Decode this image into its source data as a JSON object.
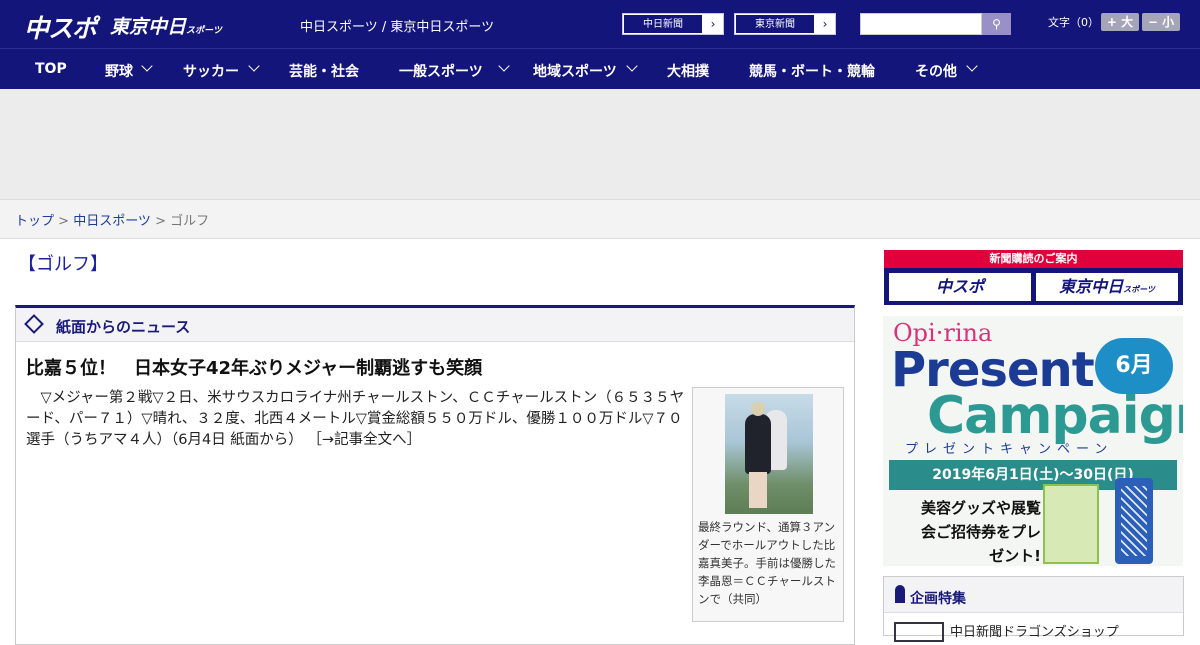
{
  "header": {
    "logo_chuspo": "中スポ",
    "logo_tokyo": "東京中日",
    "logo_tokyo_sub": "スポーツ",
    "site_links": "中日スポーツ / 東京中日スポーツ",
    "ext_links": [
      {
        "label": "中日新聞"
      },
      {
        "label": "東京新聞"
      }
    ],
    "search_placeholder": "",
    "search_icon": "search-icon",
    "font_size_label": "文字（0）",
    "font_bigger": "+ 大",
    "font_smaller": "− 小"
  },
  "nav": {
    "items": [
      {
        "label": "TOP",
        "dropdown": false
      },
      {
        "label": "野球",
        "dropdown": true
      },
      {
        "label": "サッカー",
        "dropdown": true
      },
      {
        "label": "芸能・社会",
        "dropdown": false
      },
      {
        "label": "一般スポーツ",
        "dropdown": true
      },
      {
        "label": "地域スポーツ",
        "dropdown": true
      },
      {
        "label": "大相撲",
        "dropdown": false
      },
      {
        "label": "競馬・ボート・競輪",
        "dropdown": false
      },
      {
        "label": "その他",
        "dropdown": true
      }
    ]
  },
  "breadcrumb": {
    "top": "トップ",
    "sep1": " > ",
    "chunichi": "中日スポーツ",
    "sep2": " > ",
    "current": "ゴルフ"
  },
  "category_title": "【ゴルフ】",
  "news": {
    "section_title": "紙面からのニュース",
    "article": {
      "title": "比嘉５位！　日本女子42年ぶりメジャー制覇逃すも笑顔",
      "body": "　▽メジャー第２戦▽２日、米サウスカロライナ州チャールストン、ＣＣチャールストン（６５３５ヤード、パー７１）▽晴れ、３２度、北西４メートル▽賞金総額５５０万ドル、優勝１００万ドル▽７０選手（うちアマ４人）（6月4日 紙面から）",
      "more_link": "［→記事全文へ］",
      "photo_caption": "最終ラウンド、通算３アンダーでホールアウトした比嘉真美子。手前は優勝した李晶恩＝ＣＣチャールストンで（共同）"
    }
  },
  "sidebar": {
    "subscribe_title": "新聞購読のご案内",
    "subscribe_chuspo": "中スポ",
    "subscribe_tokyo": "東京中日",
    "subscribe_tokyo_sub": "スポーツ",
    "banner": {
      "brand": "Opi·rina",
      "line1": "Present",
      "line2": "Campaign",
      "month": "6月",
      "kana": "プレゼントキャンペーン",
      "dates": "2019年6月1日(土)〜30日(日)",
      "promo": "美容グッズや展覧会ご招待券をプレゼント!"
    },
    "feature_title": "企画特集",
    "feature_item": "中日新聞ドラゴンズショップ"
  }
}
